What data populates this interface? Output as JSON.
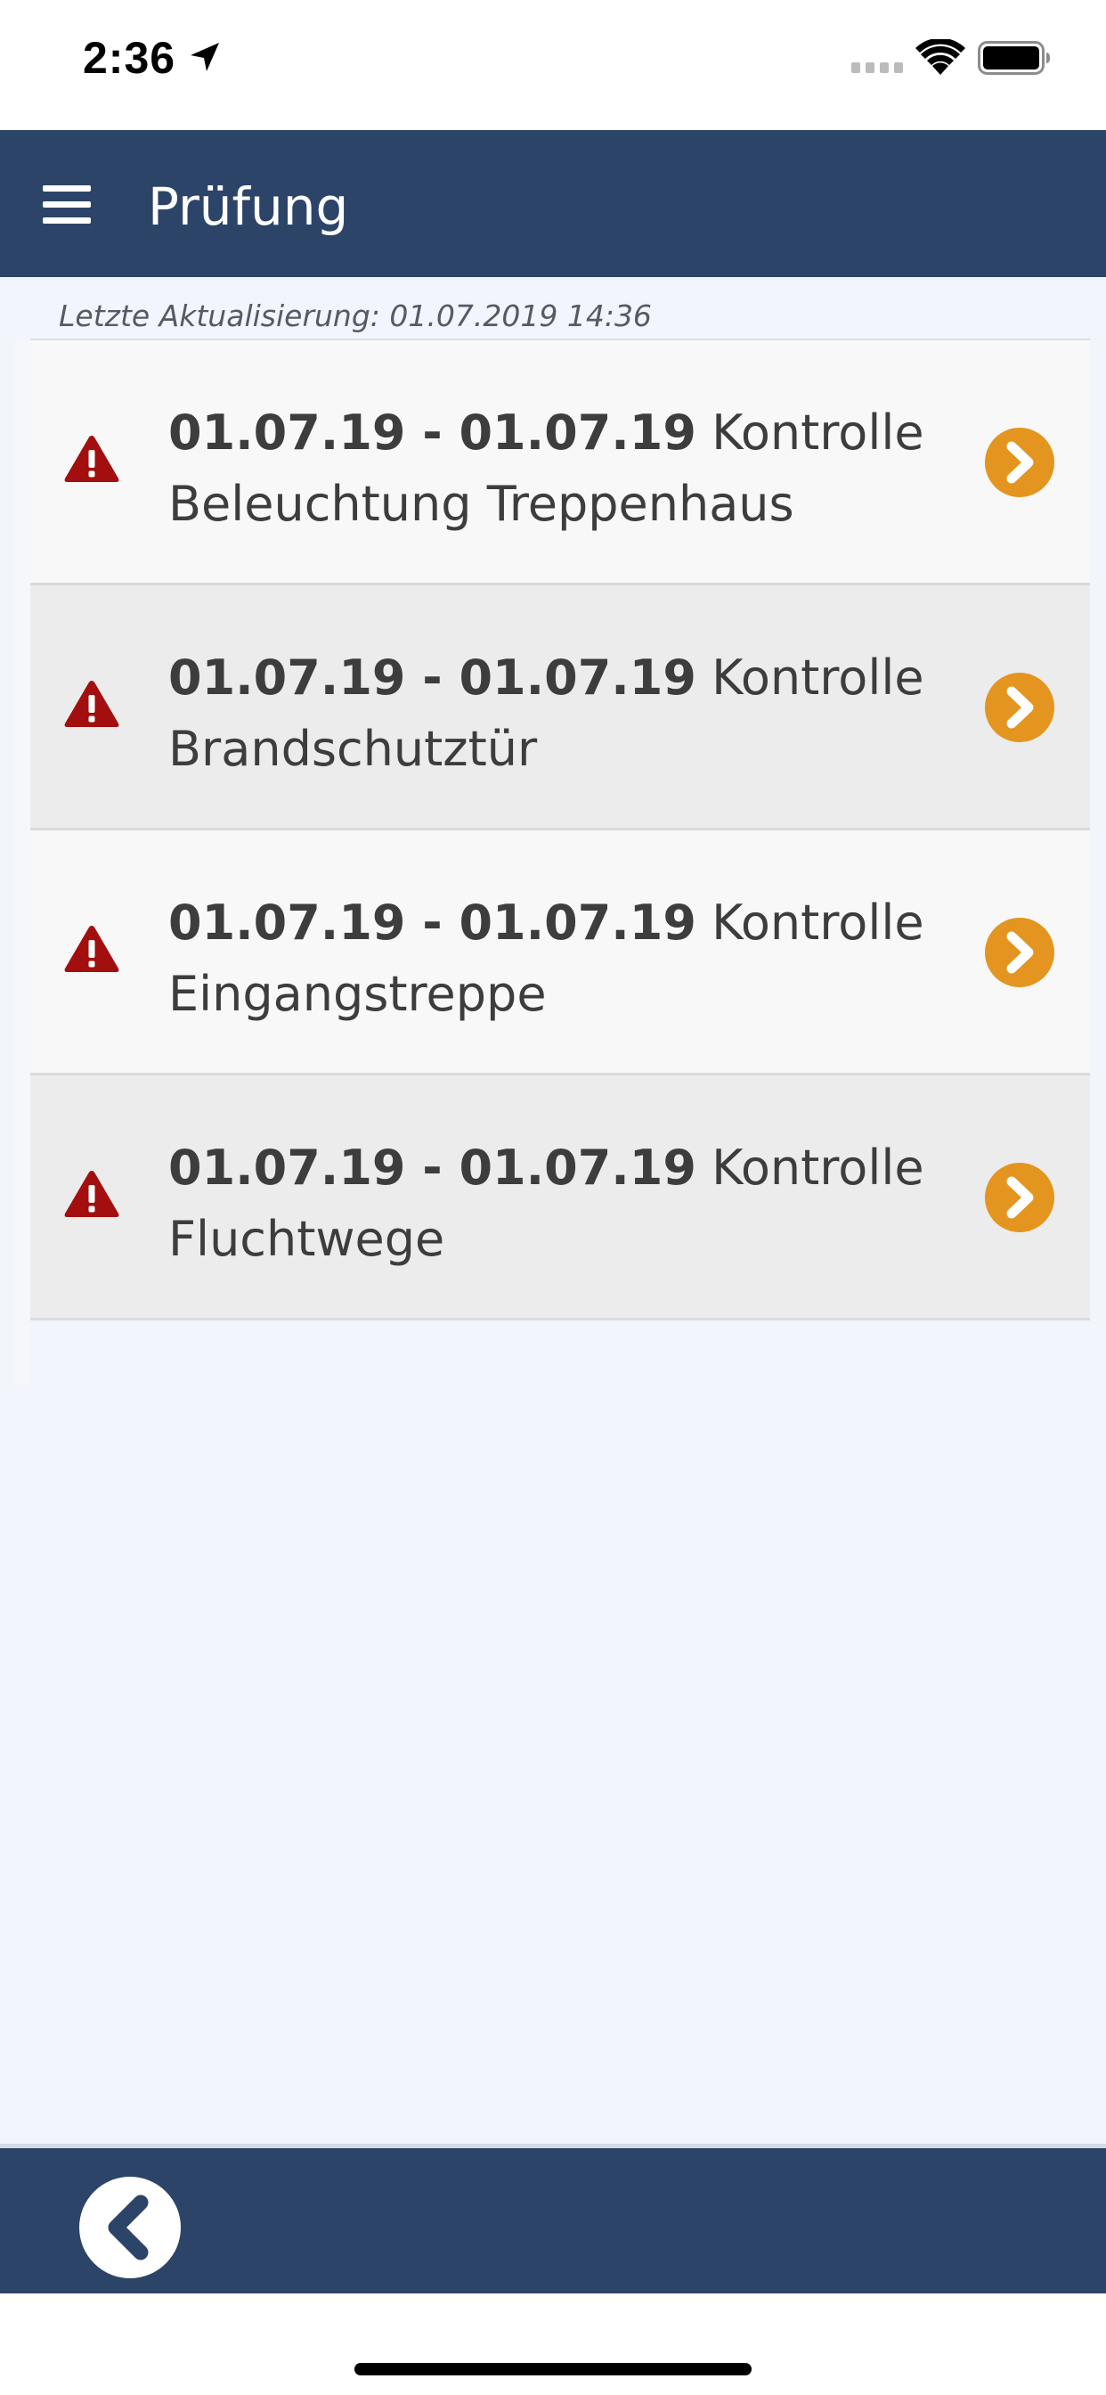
{
  "status_bar": {
    "time": "2:36",
    "icons": [
      "location-arrow-icon",
      "signal-icon",
      "wifi-icon",
      "battery-icon"
    ]
  },
  "header": {
    "title": "Prüfung",
    "menu_icon": "hamburger-menu-icon"
  },
  "last_update": "Letzte Aktualisierung: 01.07.2019 14:36",
  "tasks": [
    {
      "date_range": "01.07.19 - 01.07.19",
      "title": "Kontrolle Beleuchtung Treppenhaus",
      "status_icon": "warning-icon"
    },
    {
      "date_range": "01.07.19 - 01.07.19",
      "title": "Kontrolle Brandschutztür",
      "status_icon": "warning-icon"
    },
    {
      "date_range": "01.07.19 - 01.07.19",
      "title": "Kontrolle Eingangstreppe",
      "status_icon": "warning-icon"
    },
    {
      "date_range": "01.07.19 - 01.07.19",
      "title": "Kontrolle Fluchtwege",
      "status_icon": "warning-icon"
    }
  ],
  "bottom_bar": {
    "back_icon": "back-chevron-icon"
  },
  "colors": {
    "header": "#2d4469",
    "background": "#f2f5fc",
    "warning": "#a30f0f",
    "accent": "#e4951f"
  }
}
